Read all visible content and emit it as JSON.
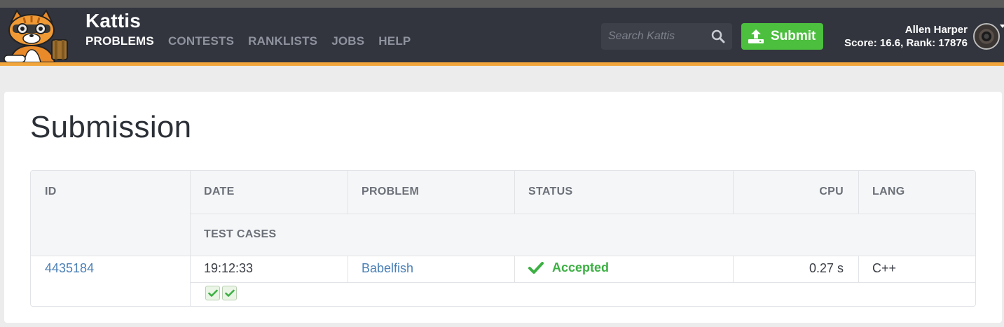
{
  "app": {
    "brand": "Kattis",
    "nav": [
      "PROBLEMS",
      "CONTESTS",
      "RANKLISTS",
      "JOBS",
      "HELP"
    ],
    "active_nav": "PROBLEMS"
  },
  "search": {
    "placeholder": "Search Kattis",
    "value": ""
  },
  "submit_label": "Submit",
  "user": {
    "name": "Allen Harper",
    "score_line": "Score: 16.6, Rank: 17876"
  },
  "page": {
    "title": "Submission"
  },
  "table": {
    "headers": {
      "id": "ID",
      "date": "DATE",
      "problem": "PROBLEM",
      "status": "STATUS",
      "cpu": "CPU",
      "lang": "LANG",
      "test_cases": "TEST CASES"
    },
    "row": {
      "id": "4435184",
      "date": "19:12:33",
      "problem": "Babelfish",
      "status": "Accepted",
      "cpu": "0.27 s",
      "lang": "C++",
      "test_cases_passed": 2,
      "test_cases_total": 2
    }
  },
  "colors": {
    "navbar": "#32353e",
    "accent": "#f2a53a",
    "submit": "#4cbf3f",
    "accepted": "#3cb043",
    "link": "#4a7fb5"
  },
  "icons": [
    "kattis-cat-logo",
    "search-icon",
    "upload-icon",
    "avatar",
    "check-icon"
  ]
}
